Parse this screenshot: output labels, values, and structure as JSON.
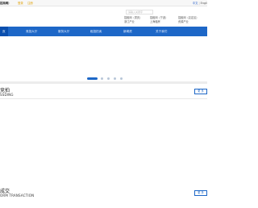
{
  "topbar": {
    "site_name": "招商网）",
    "login": "登录",
    "register": "注册",
    "lang_zh": "中文",
    "lang_sep": "|",
    "lang_en": "Engli"
  },
  "search": {
    "placeholder": "请输入关键字"
  },
  "sites": [
    "招租网（重庆）",
    "招租网（宁波）",
    "招租网（嘉定区）",
    "浙江产业",
    "上海租房",
    "资源产业"
  ],
  "nav": {
    "items": [
      "页",
      "竞投大厅",
      "服务大厅",
      "租投拍卖",
      "新闻资",
      "关于我们"
    ],
    "active_index": 0
  },
  "carousel": {
    "slides_total": 5,
    "active_index": 0
  },
  "sections": [
    {
      "title_cn": "竞拍",
      "title_en": "SSDING",
      "more": "更 多"
    },
    {
      "title_cn": "成交",
      "title_en": "ORM TRANSACTION",
      "more": "更 多"
    }
  ],
  "colors": {
    "brand_blue": "#1d67c7",
    "nav_active": "#0a4fae",
    "link_gold": "#e0a000"
  }
}
